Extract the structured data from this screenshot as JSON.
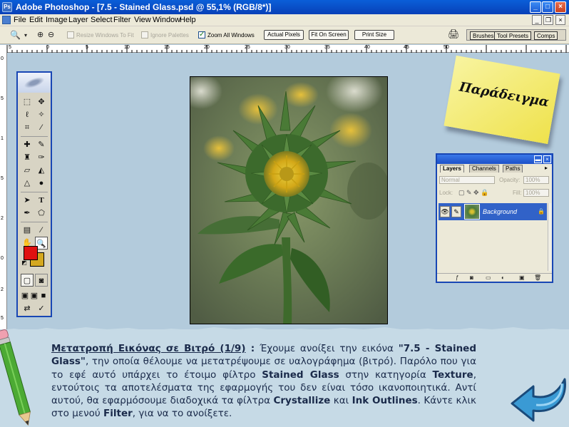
{
  "window": {
    "title": "Adobe Photoshop - [7.5 - Stained Glass.psd @ 55,1% (RGB/8*)]",
    "app_icon": "Ps",
    "buttons": {
      "minimize": "_",
      "maximize": "□",
      "close": "×"
    }
  },
  "menu": {
    "items": [
      "File",
      "Edit",
      "Image",
      "Layer",
      "Select",
      "Filter",
      "View",
      "Window",
      "Help"
    ],
    "doc_buttons": {
      "minimize": "_",
      "restore": "❐",
      "close": "×"
    }
  },
  "options": {
    "resize_windows": "Resize Windows To Fit",
    "ignore_palettes": "Ignore Palettes",
    "zoom_all_windows": "Zoom All Windows",
    "actual_pixels": "Actual Pixels",
    "fit_on_screen": "Fit On Screen",
    "print_size": "Print Size",
    "palette_well_tabs": [
      "Brushes",
      "Tool Presets",
      "Comps"
    ]
  },
  "ruler": {
    "h_labels": [
      "5",
      "0",
      "5",
      "10",
      "15",
      "20",
      "25",
      "30",
      "35",
      "40",
      "45",
      "50"
    ],
    "v_labels": [
      "0",
      "5",
      "1",
      "5",
      "2",
      "0",
      "2",
      "5",
      "3",
      "0"
    ]
  },
  "sticky_note": {
    "text": "Παράδειγμα",
    "color": "#f2e658"
  },
  "layers_panel": {
    "tabs": [
      "Layers",
      "Channels",
      "Paths"
    ],
    "blend_mode": "Normal",
    "opacity_label": "Opacity:",
    "opacity_value": "100%",
    "lock_label": "Lock:",
    "fill_label": "Fill:",
    "fill_value": "100%",
    "layer_name": "Background"
  },
  "swatches": {
    "foreground": "#e01010",
    "background": "#d4a820"
  },
  "caption": {
    "title": "Μετατροπή Εικόνας σε Βιτρό (1/9)",
    "sep": " : ",
    "t1": "Έχουμε ανοίξει την εικόνα ",
    "b1": "\"7.5 - Stained Glass\"",
    "t2": ", την οποία θέλουμε να μετατρέψουμε σε υαλογράφημα (βιτρό). Παρόλο που για το εφέ αυτό υπάρχει το έτοιμο φίλτρο ",
    "b2": "Stained Glass",
    "t3": " στην κατηγορία ",
    "b3": "Texture",
    "t4": ", εντούτοις τα αποτελέσματα της εφαρμογής του δεν είναι τόσο ικανοποιητικά. Αντί αυτού, θα εφαρμόσουμε διαδοχικά τα φίλτρα ",
    "b4": "Crystallize",
    "t5": " και ",
    "b5": "Ink Outlines",
    "t6": ". Κάντε κλικ στο μενού ",
    "b6": "Filter",
    "t7": ", για να το ανοίξετε."
  }
}
